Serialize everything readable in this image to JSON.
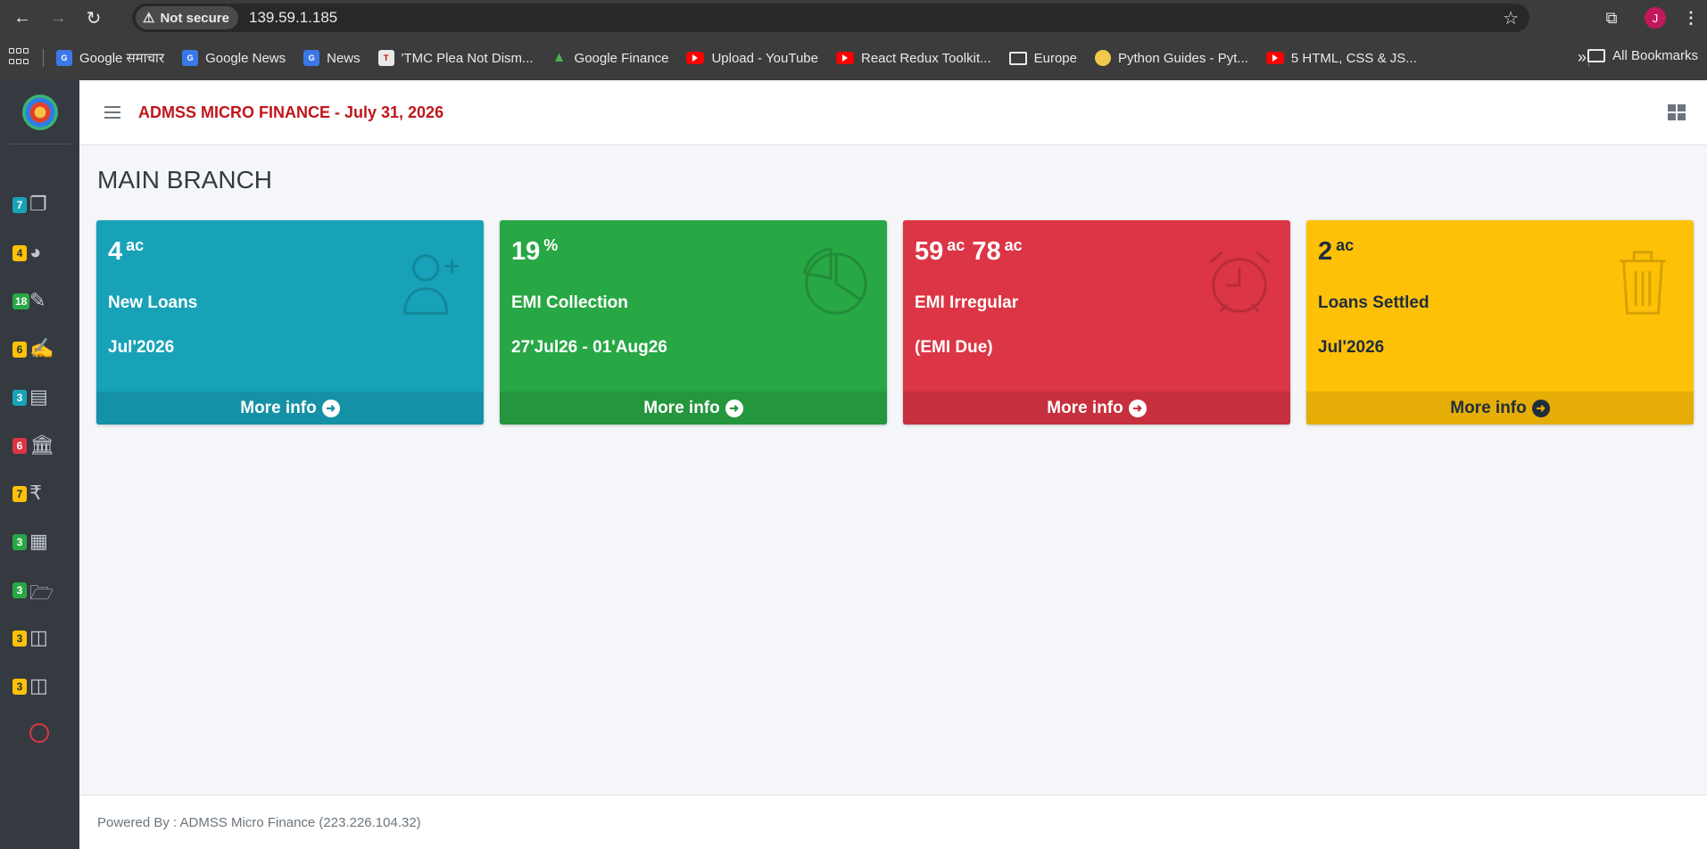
{
  "browser": {
    "security_label": "Not secure",
    "url": "139.59.1.185",
    "profile_initial": "J",
    "bookmarks": [
      {
        "label": "Google समाचार",
        "icon": "google-news-icon"
      },
      {
        "label": "Google News",
        "icon": "google-news-icon"
      },
      {
        "label": "News",
        "icon": "google-news-icon"
      },
      {
        "label": "'TMC Plea Not Dism...",
        "icon": "tmc-favicon-icon"
      },
      {
        "label": "Google Finance",
        "icon": "google-finance-icon"
      },
      {
        "label": "Upload - YouTube",
        "icon": "youtube-icon"
      },
      {
        "label": "React Redux Toolkit...",
        "icon": "youtube-icon"
      },
      {
        "label": "Europe",
        "icon": "folder-icon"
      },
      {
        "label": "Python Guides - Pyt...",
        "icon": "python-icon"
      },
      {
        "label": "5 HTML, CSS & JS...",
        "icon": "youtube-icon"
      }
    ],
    "more_label": "»",
    "all_bookmarks_label": "All Bookmarks"
  },
  "header": {
    "title": "ADMSS MICRO FINANCE - July 31, 2026"
  },
  "page": {
    "heading": "MAIN BRANCH"
  },
  "sidebar": {
    "items": [
      {
        "badge": "7",
        "badge_color": "info",
        "icon": "copy-icon"
      },
      {
        "badge": "4",
        "badge_color": "warning",
        "icon": "chart-pie-icon"
      },
      {
        "badge": "18",
        "badge_color": "success",
        "icon": "edit-icon"
      },
      {
        "badge": "6",
        "badge_color": "warning",
        "icon": "signature-icon"
      },
      {
        "badge": "3",
        "badge_color": "info",
        "icon": "id-card-icon"
      },
      {
        "badge": "6",
        "badge_color": "danger",
        "icon": "bank-icon"
      },
      {
        "badge": "7",
        "badge_color": "warning",
        "icon": "rupee-icon"
      },
      {
        "badge": "3",
        "badge_color": "success",
        "icon": "grid-icon"
      },
      {
        "badge": "3",
        "badge_color": "success",
        "icon": "folder-open-icon"
      },
      {
        "badge": "3",
        "badge_color": "warning",
        "icon": "chalkboard-user-icon"
      },
      {
        "badge": "3",
        "badge_color": "warning",
        "icon": "chalkboard-user-icon"
      }
    ],
    "power_icon": "circle-icon"
  },
  "cards": [
    {
      "value": "4",
      "unit": "ac",
      "value2": "",
      "unit2": "",
      "label": "New Loans",
      "sublabel": "Jul'2026",
      "more": "More info",
      "color": "info",
      "icon": "user-plus-icon"
    },
    {
      "value": "19",
      "unit": "%",
      "value2": "",
      "unit2": "",
      "label": "EMI Collection",
      "sublabel": "27'Jul26 - 01'Aug26",
      "more": "More info",
      "color": "success",
      "icon": "chart-pie-icon"
    },
    {
      "value": "59",
      "unit": "ac",
      "value2": "78",
      "unit2": "ac",
      "label": "EMI Irregular",
      "sublabel": "(EMI Due)",
      "more": "More info",
      "color": "danger",
      "icon": "alarm-clock-icon"
    },
    {
      "value": "2",
      "unit": "ac",
      "value2": "",
      "unit2": "",
      "label": "Loans Settled",
      "sublabel": "Jul'2026",
      "more": "More info",
      "color": "warning",
      "icon": "trash-icon"
    }
  ],
  "footer": {
    "text": "Powered By : ADMSS Micro Finance (223.226.104.32)"
  }
}
